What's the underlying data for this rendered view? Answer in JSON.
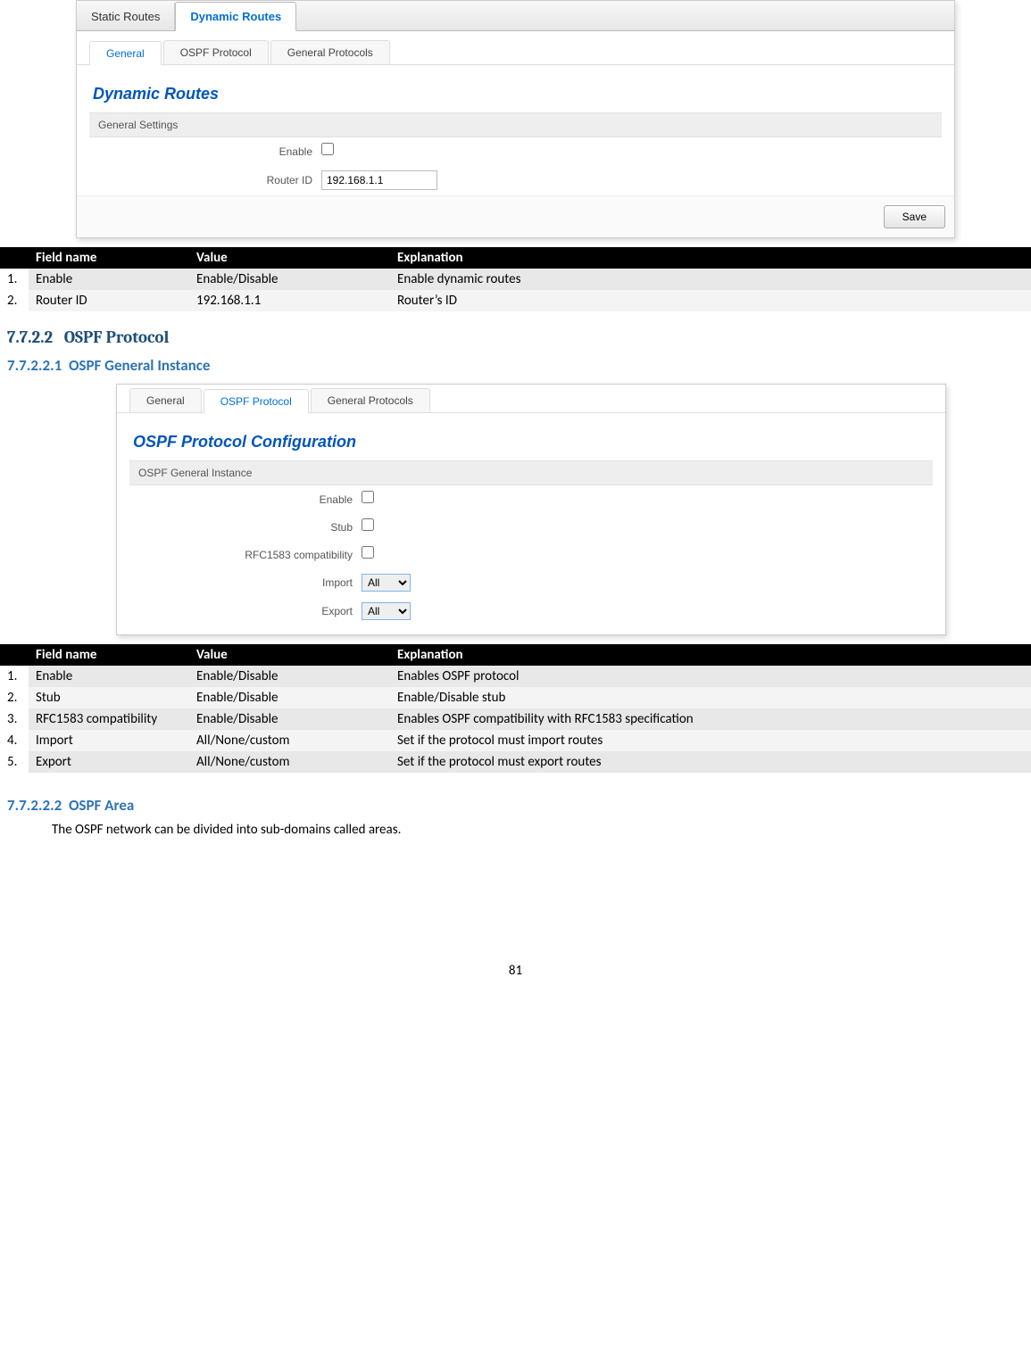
{
  "shot1": {
    "topTabs": {
      "static": "Static Routes",
      "dynamic": "Dynamic Routes"
    },
    "subTabs": {
      "general": "General",
      "ospf": "OSPF Protocol",
      "gp": "General Protocols"
    },
    "title": "Dynamic Routes",
    "section": "General Settings",
    "labels": {
      "enable": "Enable",
      "routerId": "Router ID"
    },
    "routerIdValue": "192.168.1.1",
    "save": "Save"
  },
  "table1": {
    "headers": {
      "num": "",
      "field": "Field name",
      "value": "Value",
      "expl": "Explanation"
    },
    "rows": [
      {
        "n": "1.",
        "field": "Enable",
        "value": "Enable/Disable",
        "expl": "Enable dynamic routes"
      },
      {
        "n": "2.",
        "field": "Router ID",
        "value": "192.168.1.1",
        "expl": "Router’s ID"
      }
    ]
  },
  "h3": {
    "num": "7.7.2.2",
    "text": "OSPF Protocol"
  },
  "h4a": {
    "num": "7.7.2.2.1",
    "text": "OSPF General Instance"
  },
  "shot2": {
    "subTabs": {
      "general": "General",
      "ospf": "OSPF Protocol",
      "gp": "General Protocols"
    },
    "title": "OSPF Protocol Configuration",
    "section": "OSPF General Instance",
    "labels": {
      "enable": "Enable",
      "stub": "Stub",
      "rfc": "RFC1583 compatibility",
      "import": "Import",
      "export": "Export"
    },
    "importValue": "All",
    "exportValue": "All"
  },
  "table2": {
    "headers": {
      "num": "",
      "field": "Field name",
      "value": "Value",
      "expl": "Explanation"
    },
    "rows": [
      {
        "n": "1.",
        "field": "Enable",
        "value": "Enable/Disable",
        "expl": "Enables OSPF protocol"
      },
      {
        "n": "2.",
        "field": "Stub",
        "value": "Enable/Disable",
        "expl": "Enable/Disable stub"
      },
      {
        "n": "3.",
        "field": "RFC1583 compatibility",
        "value": "Enable/Disable",
        "expl": "Enables OSPF compatibility with RFC1583 specification"
      },
      {
        "n": "4.",
        "field": "Import",
        "value": "All/None/custom",
        "expl": "Set if the protocol must import routes"
      },
      {
        "n": "5.",
        "field": "Export",
        "value": "All/None/custom",
        "expl": "Set if the protocol must export routes"
      }
    ]
  },
  "h4b": {
    "num": "7.7.2.2.2",
    "text": "OSPF Area"
  },
  "body1": "The OSPF network can be divided into sub-domains called areas.",
  "pageNumber": "81"
}
